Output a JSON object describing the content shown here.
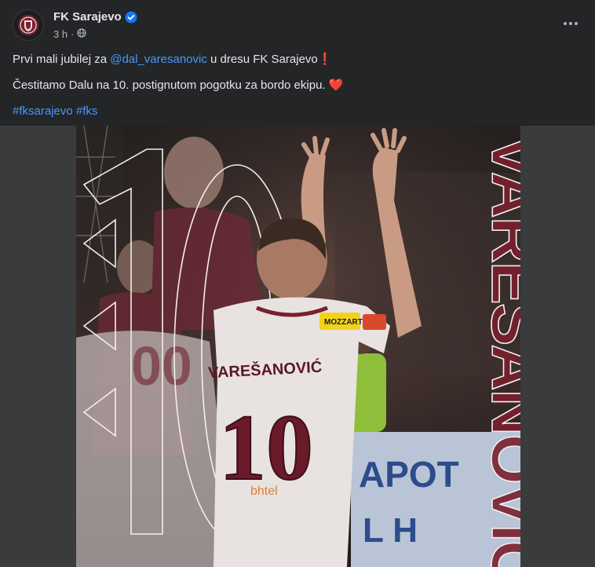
{
  "post": {
    "page_name": "FK Sarajevo",
    "time": "3 h",
    "visibility_icon": "globe-icon",
    "more_icon": "more-horizontal-icon",
    "line1_pre": "Prvi mali jubilej za ",
    "line1_mention": "@dal_varesanovic",
    "line1_post": " u dresu FK Sarajevo",
    "line1_emoji": "❗",
    "line2_text": "Čestitamo Dalu na 10. postignutom pogotku za bordo ekipu.",
    "line2_emoji": "❤️",
    "hashtag1": "#fksarajevo",
    "hashtag2": "#fks"
  },
  "image": {
    "big_number": "10",
    "player_surname": "VAREŠANOVIĆ",
    "shirt_name": "VAREŠANOVIĆ",
    "shirt_number": "10",
    "sponsor_patch": "MOZZART",
    "banner_text": "APOT",
    "colors": {
      "maroon": "#7a1f2e",
      "shirt": "#e8e3e1"
    }
  }
}
